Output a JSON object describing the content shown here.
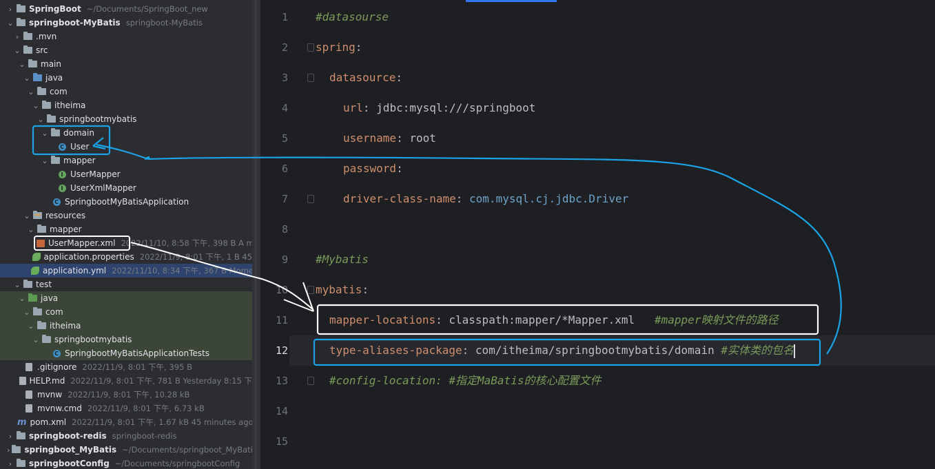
{
  "tree": {
    "rows": [
      {
        "label": "SpringBoot",
        "meta": "~/Documents/SpringBoot_new",
        "bold": true
      },
      {
        "label": "springboot-MyBatis",
        "meta": "springboot-MyBatis",
        "bold": true
      },
      {
        "label": ".mvn",
        "meta": ""
      },
      {
        "label": "src",
        "meta": ""
      },
      {
        "label": "main",
        "meta": ""
      },
      {
        "label": "java",
        "meta": ""
      },
      {
        "label": "com",
        "meta": ""
      },
      {
        "label": "itheima",
        "meta": ""
      },
      {
        "label": "springbootmybatis",
        "meta": ""
      },
      {
        "label": "domain",
        "meta": ""
      },
      {
        "label": "User",
        "meta": ""
      },
      {
        "label": "mapper",
        "meta": ""
      },
      {
        "label": "UserMapper",
        "meta": ""
      },
      {
        "label": "UserXmlMapper",
        "meta": ""
      },
      {
        "label": "SpringbootMyBatisApplication",
        "meta": ""
      },
      {
        "label": "resources",
        "meta": ""
      },
      {
        "label": "mapper",
        "meta": ""
      },
      {
        "label": "UserMapper.xml",
        "meta": "2022/11/10, 8:58 下午, 398 B A m"
      },
      {
        "label": "application.properties",
        "meta": "2022/11/9, 8:01 下午, 1 B 45"
      },
      {
        "label": "application.yml",
        "meta": "2022/11/10, 8:34 下午, 367 B Mome"
      },
      {
        "label": "test",
        "meta": ""
      },
      {
        "label": "java",
        "meta": ""
      },
      {
        "label": "com",
        "meta": ""
      },
      {
        "label": "itheima",
        "meta": ""
      },
      {
        "label": "springbootmybatis",
        "meta": ""
      },
      {
        "label": "SpringbootMyBatisApplicationTests",
        "meta": ""
      },
      {
        "label": ".gitignore",
        "meta": "2022/11/9, 8:01 下午, 395 B"
      },
      {
        "label": "HELP.md",
        "meta": "2022/11/9, 8:01 下午, 781 B Yesterday 8:15 下"
      },
      {
        "label": "mvnw",
        "meta": "2022/11/9, 8:01 下午, 10.28 kB"
      },
      {
        "label": "mvnw.cmd",
        "meta": "2022/11/9, 8:01 下午, 6.73 kB"
      },
      {
        "label": "pom.xml",
        "meta": "2022/11/9, 8:01 下午, 1.67 kB 45 minutes ago"
      },
      {
        "label": "springboot-redis",
        "meta": "springboot-redis",
        "bold": true
      },
      {
        "label": "springboot_MyBatis",
        "meta": "~/Documents/springboot_MyBatis",
        "bold": true
      },
      {
        "label": "springbootConfig",
        "meta": "~/Documents/springbootConfig",
        "bold": true
      }
    ]
  },
  "editor": {
    "line_numbers": [
      "1",
      "2",
      "3",
      "4",
      "5",
      "6",
      "7",
      "8",
      "9",
      "10",
      "11",
      "12",
      "13",
      "14",
      "15"
    ],
    "current_line": "12",
    "lines": {
      "l1": "#datasourse",
      "l2_key": "spring",
      "l2_colon": ":",
      "l3_key": "datasource",
      "l3_colon": ":",
      "l4_key": "url",
      "l4_val": ": jdbc:mysql:///springboot",
      "l5_key": "username",
      "l5_val": ": root",
      "l6_key": "password",
      "l6_val": ":",
      "l7_key": "driver-class-name",
      "l7_colon": ": ",
      "l7_val": "com.mysql.cj.jdbc.Driver",
      "l9": "#Mybatis",
      "l10_key": "mybatis",
      "l10_colon": ":",
      "l11_key": "mapper-locations",
      "l11_val": ": classpath:mapper/*Mapper.xml",
      "l11_cm": "#mapper映射文件的路径",
      "l12_key": "type-aliases-package",
      "l12_val": ": com/itheima/springbootmybatis/domain",
      "l12_cm": "#实体类的包名",
      "l13": "#config-location: #指定MaBatis的核心配置文件"
    }
  },
  "colors": {
    "annotation_blue": "#1aa3e6",
    "annotation_white": "#ffffff",
    "keyword": "#cf8e6d",
    "comment": "#7a9a5a"
  }
}
